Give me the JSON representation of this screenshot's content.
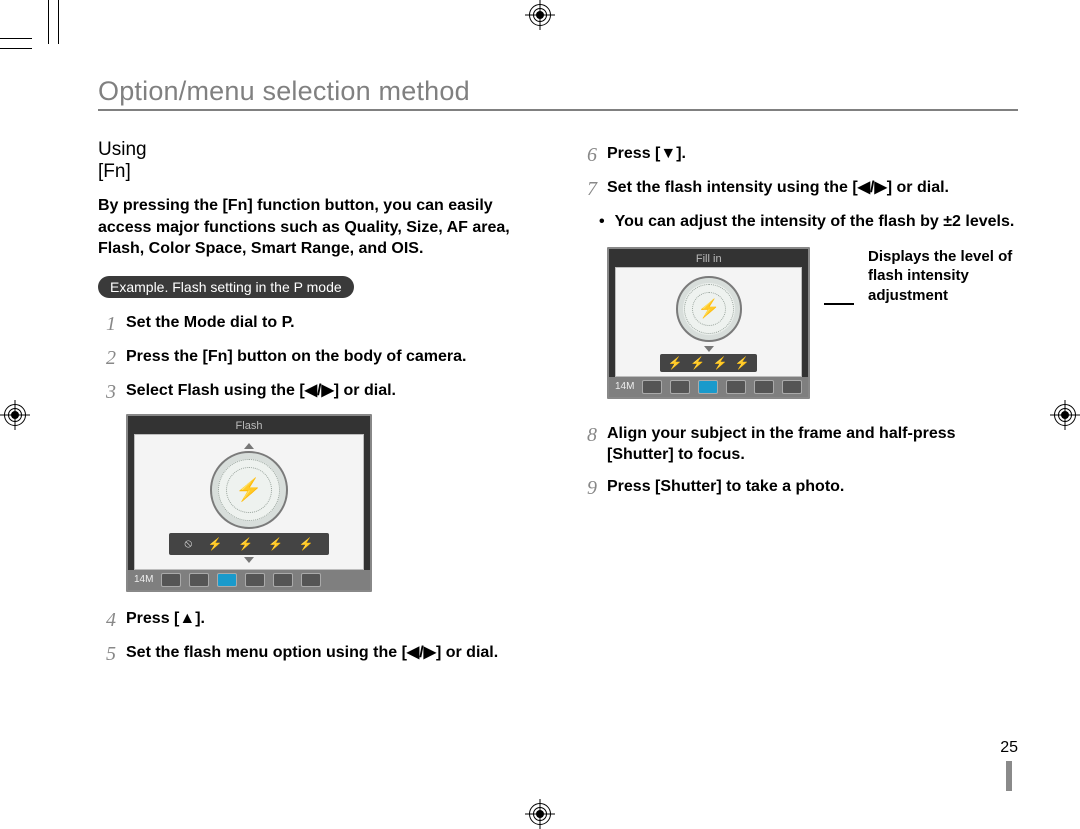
{
  "page": {
    "title": "Option/menu selection method",
    "number": "25"
  },
  "left": {
    "heading": "Using [Fn]",
    "intro_html": "By pressing the [Fn] function button, you can easily access major functions such as Quality, Size, AF area, Flash, Color Space, Smart Range, and OIS.",
    "pill": "Example. Flash setting in the P mode",
    "steps": {
      "s1_n": "1",
      "s1_t": "Set the Mode dial to P.",
      "s2_n": "2",
      "s2_t": "Press the [Fn] button on the body of camera.",
      "s3_n": "3",
      "s3_t": "Select Flash using the [◀/▶] or dial.",
      "s4_n": "4",
      "s4_t": "Press [▲].",
      "s5_n": "5",
      "s5_t": "Set the flash menu option using the [◀/▶] or dial."
    },
    "figure": {
      "title": "Flash",
      "status_left": "14M"
    }
  },
  "right": {
    "steps": {
      "s6_n": "6",
      "s6_t": "Press [▼].",
      "s7_n": "7",
      "s7_t": "Set the flash intensity using the [◀/▶] or dial.",
      "s8_n": "8",
      "s8_t": "Align your subject in the frame and half-press [Shutter] to focus.",
      "s9_n": "9",
      "s9_t": "Press [Shutter] to take a photo."
    },
    "bullet": "You can adjust the intensity of the flash by ±2 levels.",
    "figure": {
      "title": "Fill in",
      "status_left": "14M",
      "callout": "Displays the level of flash intensity adjustment"
    }
  }
}
